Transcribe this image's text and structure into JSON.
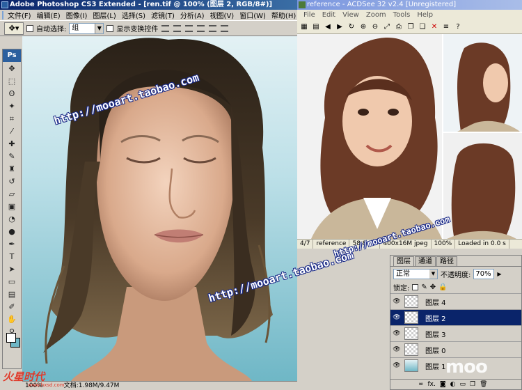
{
  "photoshop": {
    "title": "Adobe Photoshop CS3 Extended - [ren.tif @ 100% (图层 2, RGB/8#)]",
    "menu": [
      "文件(F)",
      "编辑(E)",
      "图像(I)",
      "图层(L)",
      "选择(S)",
      "滤镜(T)",
      "分析(A)",
      "视图(V)",
      "窗口(W)",
      "帮助(H)"
    ],
    "options": {
      "auto_select_label": "自动选择:",
      "auto_select_value": "组",
      "show_transform_label": "显示变换控件"
    },
    "toolbox_label": "Ps",
    "status": {
      "zoom": "100%",
      "doc": "文档:1.98M/9.47M"
    }
  },
  "acdsee": {
    "title": "reference - ACDSee 32 v2.4 [Unregistered]",
    "menu": [
      "File",
      "Edit",
      "View",
      "Zoom",
      "Tools",
      "Help"
    ],
    "status": [
      "4/7",
      "reference",
      "58.8 KB",
      "400x16M jpeg",
      "100%",
      "Loaded in 0.0 s"
    ]
  },
  "layers_panel": {
    "tabs": [
      "图层",
      "通道",
      "路径"
    ],
    "blend_mode": "正常",
    "opacity_label": "不透明度:",
    "opacity_value": "70%",
    "lock_label": "锁定:",
    "layers": [
      {
        "name": "图层 4",
        "selected": false
      },
      {
        "name": "图层 2",
        "selected": true
      },
      {
        "name": "图层 3",
        "selected": false
      },
      {
        "name": "图层 0",
        "selected": false
      },
      {
        "name": "图层 1",
        "selected": false
      }
    ],
    "footer_glyph": "fx."
  },
  "watermarks": {
    "url_1": "http://mooart.taobao.com",
    "url_2": "http://mooart.taobao.com",
    "url_3": "http://mooart.taobao.com",
    "brand": "火星时代",
    "brand_sub": "www.hxsd.com",
    "moo": "moo"
  },
  "colors": {
    "ps_title": "#0a246a",
    "acd_title": "#7a96df",
    "selected_layer": "#0a246a",
    "canvas_bg": "#6fb7c6",
    "watermark_outline": "#1a2a88"
  }
}
